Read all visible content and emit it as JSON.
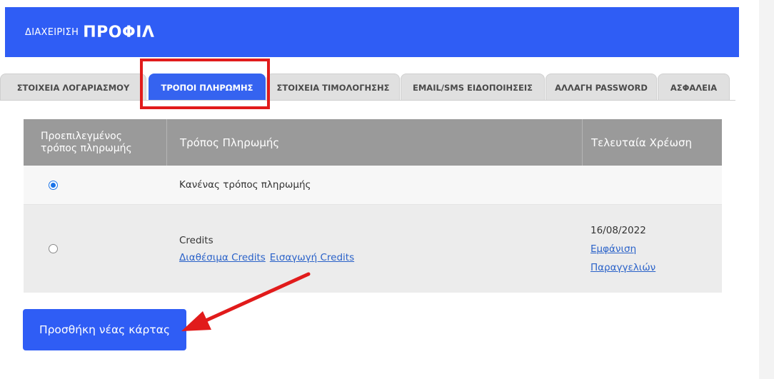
{
  "header": {
    "title_small": "ΔΙΑΧΕΙΡΙΣΗ",
    "title_big": "ΠΡΟΦΙΛ"
  },
  "tabs": [
    {
      "label": "ΣΤΟΙΧΕΙΑ ΛΟΓΑΡΙΑΣΜΟΥ",
      "active": false
    },
    {
      "label": "ΤΡΟΠΟΙ ΠΛΗΡΩΜΗΣ",
      "active": true
    },
    {
      "label": "ΣΤΟΙΧΕΙΑ ΤΙΜΟΛΟΓΗΣΗΣ",
      "active": false
    },
    {
      "label": "EMAIL/SMS ΕΙΔΟΠΟΙΗΣΕΙΣ",
      "active": false
    },
    {
      "label": "ΑΛΛΑΓΗ PASSWORD",
      "active": false
    },
    {
      "label": "ΑΣΦΑΛΕΙΑ",
      "active": false
    }
  ],
  "table": {
    "headers": {
      "default_line1": "Προεπιλεγμένος",
      "default_line2": "τρόπος πληρωμής",
      "method": "Τρόπος Πληρωμής",
      "last_charge": "Τελευταία Χρέωση"
    },
    "rows": [
      {
        "selected": true,
        "method": "Κανένας τρόπος πληρωμής",
        "last_charge": ""
      },
      {
        "selected": false,
        "method": "Credits",
        "link_available": "Διαθέσιμα Credits",
        "link_import": "Εισαγωγή Credits",
        "last_charge": "16/08/2022",
        "link_show_line1": "Εμφάνιση",
        "link_show_line2": "Παραγγελιών"
      }
    ]
  },
  "add_card_button": "Προσθήκη νέας κάρτας",
  "colors": {
    "primary": "#2f5df5",
    "annotation_red": "#e11b1b",
    "table_header": "#9a9a9a"
  }
}
